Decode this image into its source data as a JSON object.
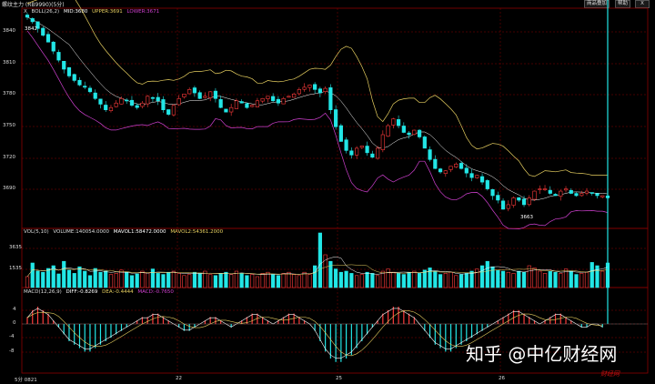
{
  "window": {
    "title": "螺纹主力 (RB9990)(5分)",
    "buttons": [
      "商品叠加",
      "帮助"
    ],
    "close": "X"
  },
  "colors": {
    "up": "#ff3b3b",
    "down": "#22e6e6",
    "mid": "#ffffff",
    "upper": "#e8d060",
    "lower": "#d040d0",
    "ma5": "#ffffff",
    "ma10": "#e8d060",
    "diff": "#ffffff",
    "dea": "#e8d060",
    "grid": "#8b0000"
  },
  "main": {
    "legend": {
      "name": "BOLL(26,2)",
      "mid": "MID:3680",
      "upper": "UPPER:3691",
      "lower": "LOWER:3671"
    },
    "yticks": [
      "3840",
      "3810",
      "3780",
      "3750",
      "3720",
      "3690"
    ],
    "high_label": "3842",
    "low_label": "3663"
  },
  "volume": {
    "legend": {
      "name": "VOL(5,10)",
      "volume": "VOLUME:140054.0000",
      "mavol1": "MAVOL1:58472.0000",
      "mavol2": "MAVOL2:54361.2000"
    },
    "yticks": [
      "3635",
      "1535"
    ]
  },
  "macd": {
    "legend": {
      "name": "MACD(12,26,9)",
      "diff": "DIFF:-0.8269",
      "dea": "DEA:-0.4444",
      "macd": "MACD:-0.7650"
    },
    "yticks": [
      "4",
      "0",
      "-4",
      "-8"
    ]
  },
  "xaxis": {
    "labels": [
      "5分 0821",
      "22",
      "25",
      "26"
    ]
  },
  "watermark": {
    "text": "知乎 @中亿财经网",
    "brand": "财经网"
  },
  "chart_data": {
    "type": "candlestick",
    "price_range": [
      3655,
      3850
    ],
    "close_path": [
      3842,
      3838,
      3832,
      3826,
      3820,
      3812,
      3804,
      3796,
      3790,
      3786,
      3782,
      3780,
      3776,
      3770,
      3765,
      3760,
      3762,
      3766,
      3770,
      3768,
      3764,
      3762,
      3766,
      3772,
      3770,
      3768,
      3760,
      3756,
      3764,
      3770,
      3774,
      3778,
      3775,
      3770,
      3772,
      3776,
      3770,
      3762,
      3758,
      3762,
      3768,
      3766,
      3762,
      3764,
      3768,
      3770,
      3772,
      3768,
      3766,
      3770,
      3772,
      3774,
      3778,
      3780,
      3782,
      3778,
      3775,
      3779,
      3760,
      3745,
      3732,
      3724,
      3720,
      3726,
      3728,
      3722,
      3718,
      3726,
      3738,
      3746,
      3752,
      3746,
      3740,
      3738,
      3742,
      3736,
      3726,
      3716,
      3708,
      3705,
      3706,
      3710,
      3712,
      3708,
      3704,
      3700,
      3702,
      3696,
      3690,
      3684,
      3680,
      3672,
      3676,
      3682,
      3680,
      3676,
      3682,
      3688,
      3690,
      3690,
      3686,
      3684,
      3688,
      3690,
      3686,
      3684,
      3686,
      3688,
      3686,
      3684,
      3684,
      3682
    ],
    "volume_path": [
      20,
      45,
      30,
      28,
      35,
      40,
      25,
      48,
      32,
      26,
      38,
      30,
      22,
      35,
      28,
      30,
      24,
      26,
      32,
      28,
      22,
      25,
      30,
      27,
      34,
      26,
      24,
      28,
      30,
      26,
      22,
      24,
      28,
      26,
      30,
      24,
      22,
      26,
      28,
      24,
      30,
      26,
      22,
      24,
      20,
      26,
      28,
      24,
      22,
      26,
      28,
      24,
      22,
      28,
      24,
      40,
      100,
      60,
      48,
      34,
      28,
      30,
      26,
      22,
      24,
      28,
      26,
      22,
      30,
      34,
      28,
      26,
      24,
      28,
      30,
      26,
      32,
      36,
      30,
      24,
      26,
      28,
      22,
      24,
      26,
      30,
      34,
      40,
      48,
      38,
      32,
      30,
      28,
      26,
      30,
      28,
      40,
      36,
      30,
      26,
      30,
      28,
      26,
      34,
      30,
      24,
      26,
      28,
      46,
      40,
      30,
      45
    ],
    "macd_path": [
      2,
      4,
      5,
      4,
      3,
      1,
      -1,
      -3,
      -5,
      -6,
      -7,
      -8,
      -8,
      -7,
      -6,
      -5,
      -4,
      -3,
      -2,
      -1,
      0,
      1,
      2,
      2,
      3,
      3,
      2,
      1,
      0,
      -1,
      -2,
      -2,
      -1,
      0,
      1,
      2,
      2,
      1,
      0,
      -1,
      0,
      1,
      2,
      3,
      3,
      2,
      1,
      0,
      1,
      2,
      3,
      3,
      2,
      1,
      0,
      -2,
      -5,
      -8,
      -10,
      -11,
      -11,
      -10,
      -9,
      -7,
      -5,
      -3,
      -1,
      1,
      3,
      4,
      5,
      5,
      4,
      3,
      2,
      0,
      -2,
      -4,
      -6,
      -7,
      -8,
      -8,
      -7,
      -6,
      -5,
      -4,
      -3,
      -2,
      -1,
      0,
      1,
      2,
      3,
      4,
      4,
      3,
      2,
      1,
      0,
      1,
      2,
      3,
      3,
      2,
      1,
      0,
      -1,
      -1,
      0,
      0,
      -1
    ]
  }
}
